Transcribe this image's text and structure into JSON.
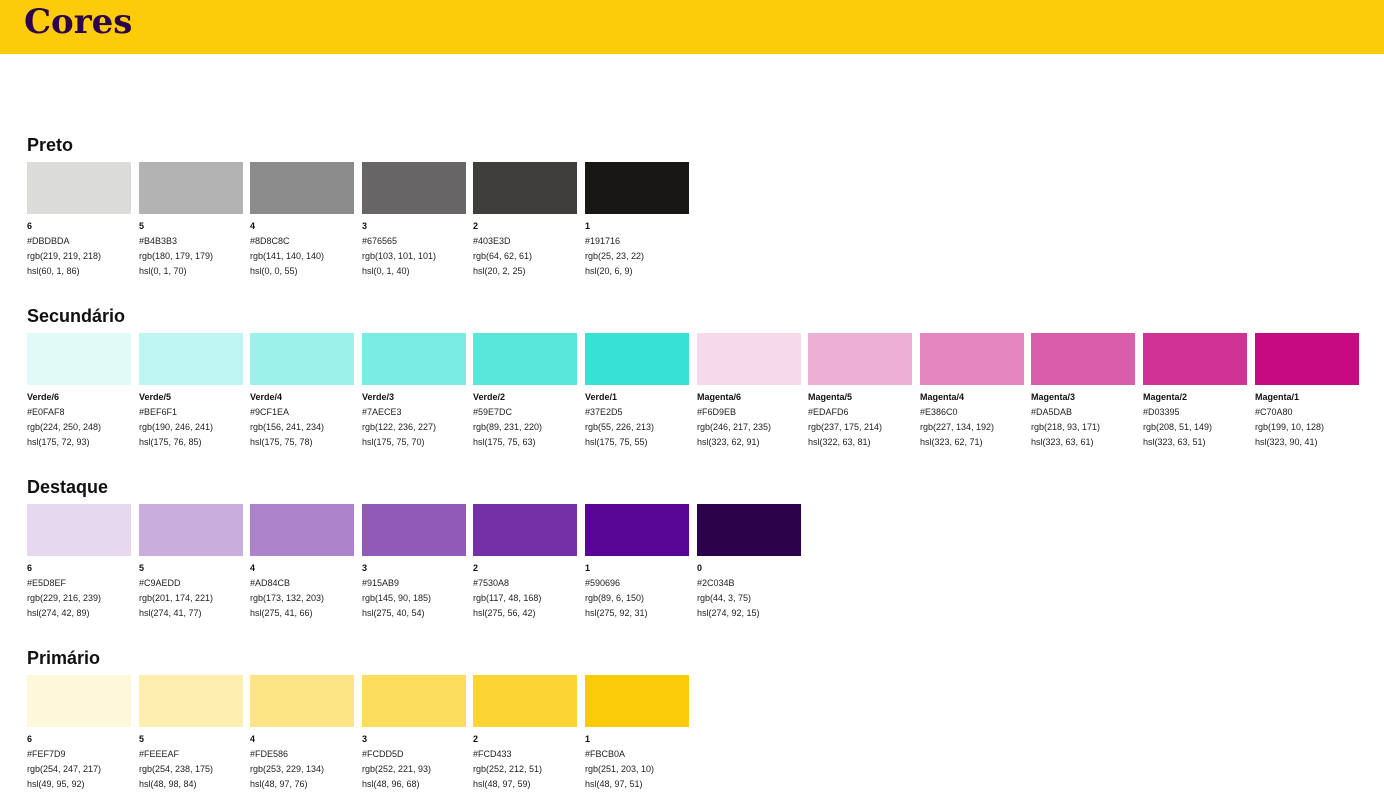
{
  "header": {
    "title": "Cores",
    "bg": "#FCCC0A",
    "fg": "#2C034B"
  },
  "sections": [
    {
      "title": "Preto",
      "swatches": [
        {
          "name": "6",
          "hex": "#DBDBDA",
          "rgb": "rgb(219, 219, 218)",
          "hsl": "hsl(60, 1, 86)"
        },
        {
          "name": "5",
          "hex": "#B4B3B3",
          "rgb": "rgb(180, 179, 179)",
          "hsl": "hsl(0, 1, 70)"
        },
        {
          "name": "4",
          "hex": "#8D8C8C",
          "rgb": "rgb(141, 140, 140)",
          "hsl": "hsl(0, 0, 55)"
        },
        {
          "name": "3",
          "hex": "#676565",
          "rgb": "rgb(103, 101, 101)",
          "hsl": "hsl(0, 1, 40)"
        },
        {
          "name": "2",
          "hex": "#403E3D",
          "rgb": "rgb(64, 62, 61)",
          "hsl": "hsl(20, 2, 25)"
        },
        {
          "name": "1",
          "hex": "#191716",
          "rgb": "rgb(25, 23, 22)",
          "hsl": "hsl(20, 6, 9)"
        }
      ]
    },
    {
      "title": "Secundário",
      "swatches": [
        {
          "name": "Verde/6",
          "hex": "#E0FAF8",
          "rgb": "rgb(224, 250, 248)",
          "hsl": "hsl(175, 72, 93)"
        },
        {
          "name": "Verde/5",
          "hex": "#BEF6F1",
          "rgb": "rgb(190, 246, 241)",
          "hsl": "hsl(175, 76, 85)"
        },
        {
          "name": "Verde/4",
          "hex": "#9CF1EA",
          "rgb": "rgb(156, 241, 234)",
          "hsl": "hsl(175, 75, 78)"
        },
        {
          "name": "Verde/3",
          "hex": "#7AECE3",
          "rgb": "rgb(122, 236, 227)",
          "hsl": "hsl(175, 75, 70)"
        },
        {
          "name": "Verde/2",
          "hex": "#59E7DC",
          "rgb": "rgb(89, 231, 220)",
          "hsl": "hsl(175, 75, 63)"
        },
        {
          "name": "Verde/1",
          "hex": "#37E2D5",
          "rgb": "rgb(55, 226, 213)",
          "hsl": "hsl(175, 75, 55)"
        },
        {
          "name": "Magenta/6",
          "hex": "#F6D9EB",
          "rgb": "rgb(246, 217, 235)",
          "hsl": "hsl(323, 62, 91)"
        },
        {
          "name": "Magenta/5",
          "hex": "#EDAFD6",
          "rgb": "rgb(237, 175, 214)",
          "hsl": "hsl(322, 63, 81)"
        },
        {
          "name": "Magenta/4",
          "hex": "#E386C0",
          "rgb": "rgb(227, 134, 192)",
          "hsl": "hsl(323, 62, 71)"
        },
        {
          "name": "Magenta/3",
          "hex": "#DA5DAB",
          "rgb": "rgb(218, 93, 171)",
          "hsl": "hsl(323, 63, 61)"
        },
        {
          "name": "Magenta/2",
          "hex": "#D03395",
          "rgb": "rgb(208, 51, 149)",
          "hsl": "hsl(323, 63, 51)"
        },
        {
          "name": "Magenta/1",
          "hex": "#C70A80",
          "rgb": "rgb(199, 10, 128)",
          "hsl": "hsl(323, 90, 41)"
        }
      ]
    },
    {
      "title": "Destaque",
      "swatches": [
        {
          "name": "6",
          "hex": "#E5D8EF",
          "rgb": "rgb(229, 216, 239)",
          "hsl": "hsl(274, 42, 89)"
        },
        {
          "name": "5",
          "hex": "#C9AEDD",
          "rgb": "rgb(201, 174, 221)",
          "hsl": "hsl(274, 41, 77)"
        },
        {
          "name": "4",
          "hex": "#AD84CB",
          "rgb": "rgb(173, 132, 203)",
          "hsl": "hsl(275, 41, 66)"
        },
        {
          "name": "3",
          "hex": "#915AB9",
          "rgb": "rgb(145, 90, 185)",
          "hsl": "hsl(275, 40, 54)"
        },
        {
          "name": "2",
          "hex": "#7530A8",
          "rgb": "rgb(117, 48, 168)",
          "hsl": "hsl(275, 56, 42)"
        },
        {
          "name": "1",
          "hex": "#590696",
          "rgb": "rgb(89, 6, 150)",
          "hsl": "hsl(275, 92, 31)"
        },
        {
          "name": "0",
          "hex": "#2C034B",
          "rgb": "rgb(44, 3, 75)",
          "hsl": "hsl(274, 92, 15)"
        }
      ]
    },
    {
      "title": "Primário",
      "swatches": [
        {
          "name": "6",
          "hex": "#FEF7D9",
          "rgb": "rgb(254, 247, 217)",
          "hsl": "hsl(49, 95, 92)"
        },
        {
          "name": "5",
          "hex": "#FEEEAF",
          "rgb": "rgb(254, 238, 175)",
          "hsl": "hsl(48, 98, 84)"
        },
        {
          "name": "4",
          "hex": "#FDE586",
          "rgb": "rgb(253, 229, 134)",
          "hsl": "hsl(48, 97, 76)"
        },
        {
          "name": "3",
          "hex": "#FCDD5D",
          "rgb": "rgb(252, 221, 93)",
          "hsl": "hsl(48, 96, 68)"
        },
        {
          "name": "2",
          "hex": "#FCD433",
          "rgb": "rgb(252, 212, 51)",
          "hsl": "hsl(48, 97, 59)"
        },
        {
          "name": "1",
          "hex": "#FBCB0A",
          "rgb": "rgb(251, 203, 10)",
          "hsl": "hsl(48, 97, 51)"
        }
      ]
    }
  ]
}
